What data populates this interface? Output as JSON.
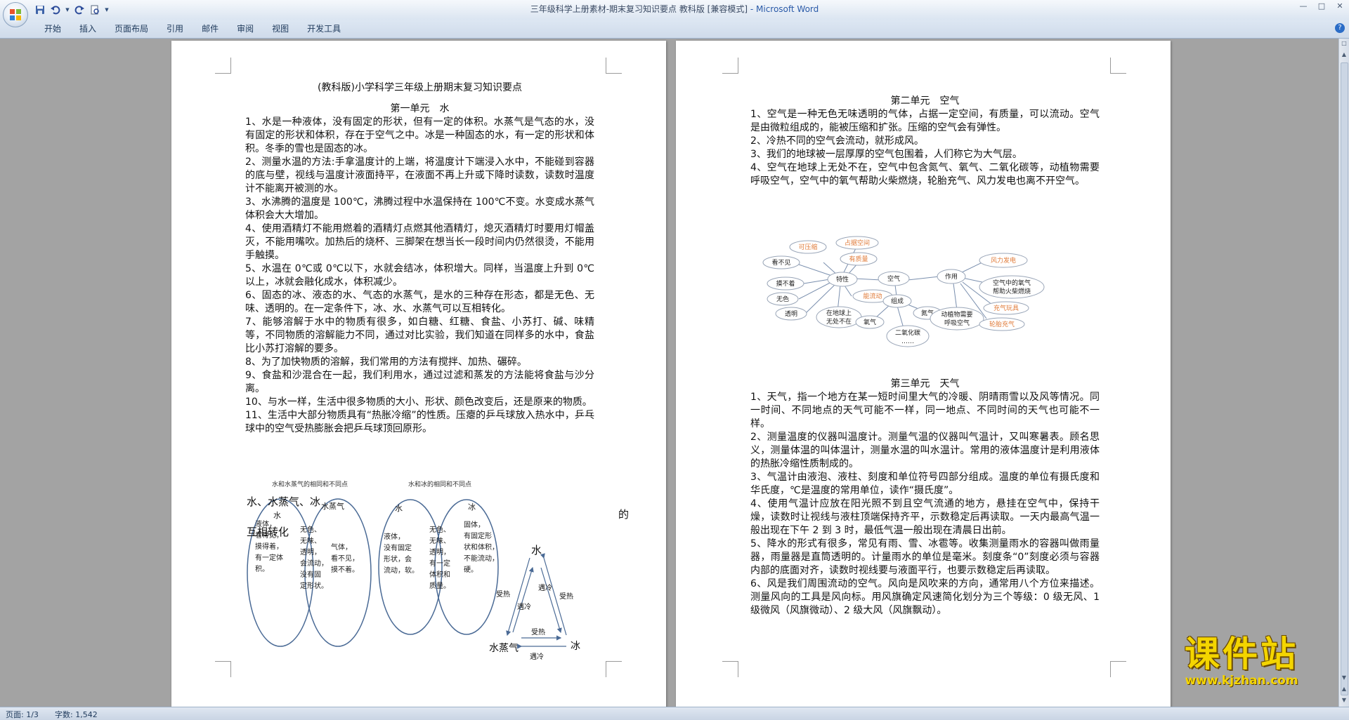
{
  "window": {
    "title": "三年级科学上册素材-期末复习知识要点 教科版 [兼容模式]",
    "app": " - Microsoft Word"
  },
  "ribbon": {
    "tabs": [
      "开始",
      "插入",
      "页面布局",
      "引用",
      "邮件",
      "审阅",
      "视图",
      "开发工具"
    ]
  },
  "page1": {
    "title": "(教科版)小学科学三年级上册期末复习知识要点",
    "unit": "第一单元　水",
    "paragraphs": [
      "1、水是一种液体，没有固定的形状，但有一定的体积。水蒸气是气态的水，没有固定的形状和体积，存在于空气之中。冰是一种固态的水，有一定的形状和体积。冬季的雪也是固态的冰。",
      "2、测量水温的方法:手拿温度计的上端，将温度计下端浸入水中，不能碰到容器的底与壁，视线与温度计液面持平，在液面不再上升或下降时读数，读数时温度计不能离开被测的水。",
      "3、水沸腾的温度是 100℃，沸腾过程中水温保持在 100℃不变。水变成水蒸气体积会大大增加。",
      "4、使用酒精灯不能用燃着的酒精灯点燃其他酒精灯，熄灭酒精灯时要用灯帽盖灭，不能用嘴吹。加热后的烧杯、三脚架在想当长一段时间内仍然很烫，不能用手触摸。",
      "5、水温在 0℃或 0℃以下，水就会结冰，体积增大。同样，当温度上升到 0℃以上，冰就会融化成水，体积减少。",
      "6、固态的冰、液态的水、气态的水蒸气，是水的三种存在形态，都是无色、无味、透明的。在一定条件下，冰、水、水蒸气可以互相转化。",
      "7、能够溶解于水中的物质有很多，如白糖、红糖、食盐、小苏打、碱、味精等，不同物质的溶解能力不同，通过对比实验，我们知道在同样多的水中，食盐比小苏打溶解的要多。",
      "8、为了加快物质的溶解，我们常用的方法有搅拌、加热、碾碎。",
      "9、食盐和沙混合在一起，我们利用水，通过过滤和蒸发的方法能将食盐与沙分离。",
      "10、与水一样，生活中很多物质的大小、形状、颜色改变后，还是原来的物质。",
      "11、生活中大部分物质具有“热胀冷缩”的性质。压瘪的乒乓球放入热水中，乒乓球中的空气受热膨胀会把乒乓球顶回原形。"
    ],
    "overlay_left_1": "水、水蒸气、冰",
    "overlay_left_2": "互相转化",
    "overlay_right": "的",
    "venn1": {
      "title": "水和水蒸气的相同和不同点",
      "left_label": "水",
      "left_text": [
        "液体，",
        "看得见，",
        "摸得着，",
        "有一定体",
        "积。"
      ],
      "middle_text": [
        "无色、",
        "无味、",
        "透明，",
        "会流动，",
        "没有固",
        "定形状。"
      ],
      "right_label": "水蒸气",
      "right_text": [
        "气体，",
        "看不见，",
        "摸不着。"
      ]
    },
    "venn2": {
      "title": "水和冰的相同和不同点",
      "left_label": "水",
      "left_text": [
        "液体，",
        "没有固定",
        "形状，会",
        "流动，软。"
      ],
      "middle_text": [
        "无色、",
        "无味、",
        "透明，",
        "有一定",
        "体积和",
        "质量。"
      ],
      "right_label": "冰",
      "right_text": [
        "固体，",
        "有固定形",
        "状和体积，",
        "不能流动，",
        "硬。"
      ]
    },
    "cycle": {
      "water": "水",
      "vapor": "水蒸气",
      "ice": "冰",
      "heat": "受热",
      "cool": "遇冷"
    }
  },
  "page2": {
    "unit2": "第二单元　空气",
    "unit2_paragraphs": [
      "1、空气是一种无色无味透明的气体，占据一定空间，有质量，可以流动。空气是由微粒组成的，能被压缩和扩张。压缩的空气会有弹性。",
      "2、冷热不同的空气会流动，就形成风。",
      "3、我们的地球被一层厚厚的空气包围着，人们称它为大气层。",
      "4、空气在地球上无处不在，空气中包含氮气、氧气、二氧化碳等，动植物需要呼吸空气，空气中的氧气帮助火柴燃烧，轮胎充气、风力发电也离不开空气。"
    ],
    "mindmap": {
      "center": "空气",
      "traits": "特性",
      "composition": "组成",
      "uses": "作用",
      "compressible": "可压缩",
      "occupies_space": "占据空间",
      "has_mass": "有质量",
      "invisible": "看不见",
      "intangible": "摸不着",
      "colorless": "无色",
      "transparent": "透明",
      "flows": "能流动",
      "everywhere": [
        "在地球上",
        "无处不在"
      ],
      "nitrogen": "氮气",
      "oxygen": "氧气",
      "co2": [
        "二氧化碳",
        "……"
      ],
      "wind_power": "风力发电",
      "oxygen_burn": [
        "空气中的氧气",
        "帮助火柴燃烧"
      ],
      "breathe": [
        "动植物需要",
        "呼吸空气"
      ],
      "inflatable_toy": "充气玩具",
      "tire_inflate": "轮胎充气"
    },
    "unit3": "第三单元　天气",
    "unit3_paragraphs": [
      "1、天气，指一个地方在某一短时间里大气的冷暖、阴晴雨雪以及风等情况。同一时间、不同地点的天气可能不一样，同一地点、不同时间的天气也可能不一样。",
      "2、测量温度的仪器叫温度计。测量气温的仪器叫气温计，又叫寒暑表。顾名思义，测量体温的叫体温计，测量水温的叫水温计。常用的液体温度计是利用液体的热胀冷缩性质制成的。",
      "3、气温计由液泡、液柱、刻度和单位符号四部分组成。温度的单位有摄氏度和华氏度，℃是温度的常用单位，读作“摄氏度”。",
      "4、使用气温计应放在阳光照不到且空气流通的地方，悬挂在空气中，保持干燥，读数时让视线与液柱顶端保持齐平，示数稳定后再读取。一天内最高气温一般出现在下午 2 到 3 时，最低气温一般出现在清晨日出前。",
      "5、降水的形式有很多，常见有雨、雪、冰雹等。收集测量雨水的容器叫做雨量器，雨量器是直筒透明的。计量雨水的单位是毫米。刻度条“0”刻度必须与容器内部的底面对齐，读数时视线要与液面平行，也要示数稳定后再读取。",
      "6、风是我们周围流动的空气。风向是风吹来的方向，通常用八个方位来描述。测量风向的工具是风向标。用风旗确定风速简化划分为三个等级：0 级无风、1 级微风（风旗微动）、2 级大风（风旗飘动）。"
    ]
  },
  "status": {
    "page": "页面: 1/3",
    "words": "字数: 1,542"
  },
  "watermark": {
    "logo": "课件站",
    "url": "www.kjzhan.com"
  },
  "colors": {
    "ribbon": "#dbe5f1",
    "doc_background": "#a3a3a3",
    "diagram_blue": "#4a6a95",
    "mindmap_orange": "#e07b39",
    "watermark_yellow": "#f4d500"
  }
}
